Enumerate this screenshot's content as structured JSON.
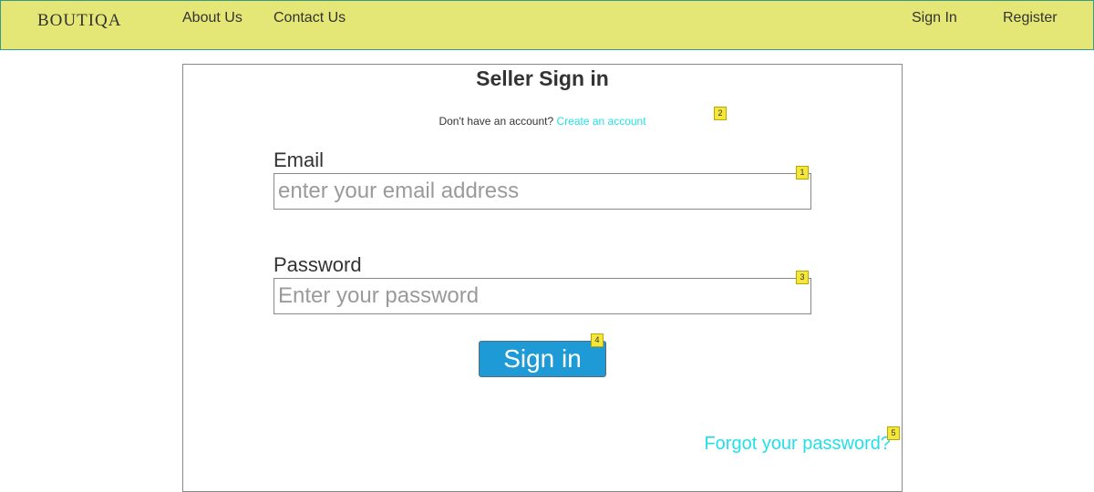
{
  "navbar": {
    "logo": "BOUTIQA",
    "links": [
      {
        "label": "About Us"
      },
      {
        "label": "Contact Us"
      }
    ],
    "auth": {
      "signin_label": "Sign In",
      "register_label": "Register"
    }
  },
  "form": {
    "title": "Seller Sign in",
    "signup_prompt": "Don't have an account?",
    "signup_link": "Create an account",
    "email": {
      "label": "Email",
      "placeholder": "enter your email address",
      "value": ""
    },
    "password": {
      "label": "Password",
      "placeholder": "Enter your password",
      "value": ""
    },
    "submit_label": "Sign in",
    "forgot_link": "Forgot your password?"
  },
  "markers": [
    "1",
    "2",
    "3",
    "4",
    "5"
  ],
  "colors": {
    "navbar_bg": "#e4e775",
    "link_accent": "#22e0e8",
    "button_bg": "#1e9bd7",
    "marker_bg": "#f5e63a"
  }
}
